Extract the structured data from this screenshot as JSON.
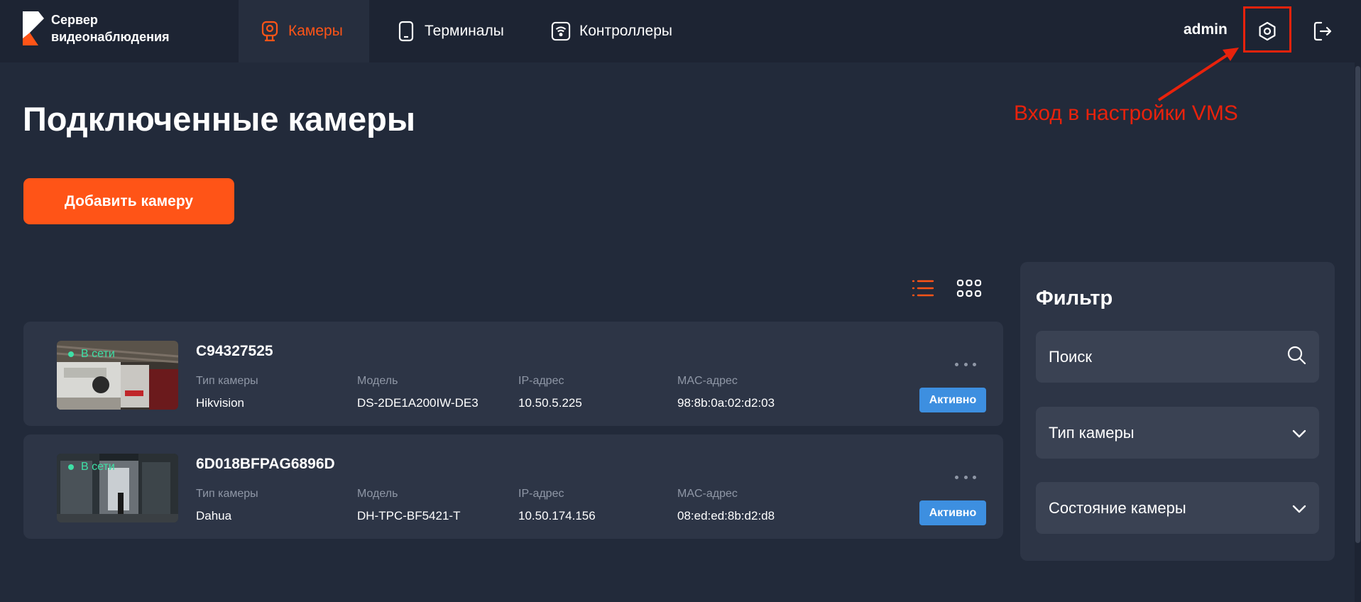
{
  "app": {
    "logo_line1": "Сервер",
    "logo_line2": "видеонаблюдения"
  },
  "nav": {
    "tabs": [
      {
        "label": "Камеры",
        "active": true
      },
      {
        "label": "Терминалы",
        "active": false
      },
      {
        "label": "Контроллеры",
        "active": false
      }
    ],
    "user": "admin"
  },
  "annotation": {
    "text": "Вход в настройки VMS"
  },
  "page": {
    "title": "Подключенные камеры",
    "add_button": "Добавить камеру"
  },
  "fields": {
    "type": "Тип камеры",
    "model": "Модель",
    "ip": "IP-адрес",
    "mac": "MAC-адрес"
  },
  "cameras": [
    {
      "name": "C94327525",
      "status": "В сети",
      "type": "Hikvision",
      "model": "DS-2DE1A200IW-DE3",
      "ip": "10.50.5.225",
      "mac": "98:8b:0a:02:d2:03",
      "badge": "Активно"
    },
    {
      "name": "6D018BFPAG6896D",
      "status": "В сети",
      "type": "Dahua",
      "model": "DH-TPC-BF5421-T",
      "ip": "10.50.174.156",
      "mac": "08:ed:ed:8b:d2:d8",
      "badge": "Активно"
    }
  ],
  "filter": {
    "title": "Фильтр",
    "search_placeholder": "Поиск",
    "camera_type": "Тип камеры",
    "camera_state": "Состояние камеры"
  },
  "colors": {
    "accent": "#ff5417",
    "background": "#222a3a",
    "card": "#2d3546",
    "online": "#3ee0a6",
    "active_badge": "#3d8fe0",
    "annotation": "#e8220c"
  },
  "icons": {
    "tab_cameras": "webcam-icon",
    "tab_terminals": "tablet-icon",
    "tab_controllers": "wifi-router-icon",
    "settings": "gear-icon",
    "logout": "logout-icon",
    "list_view": "list-view-icon",
    "grid_view": "grid-view-icon",
    "search": "search-icon",
    "dropdown": "chevron-down-icon"
  }
}
